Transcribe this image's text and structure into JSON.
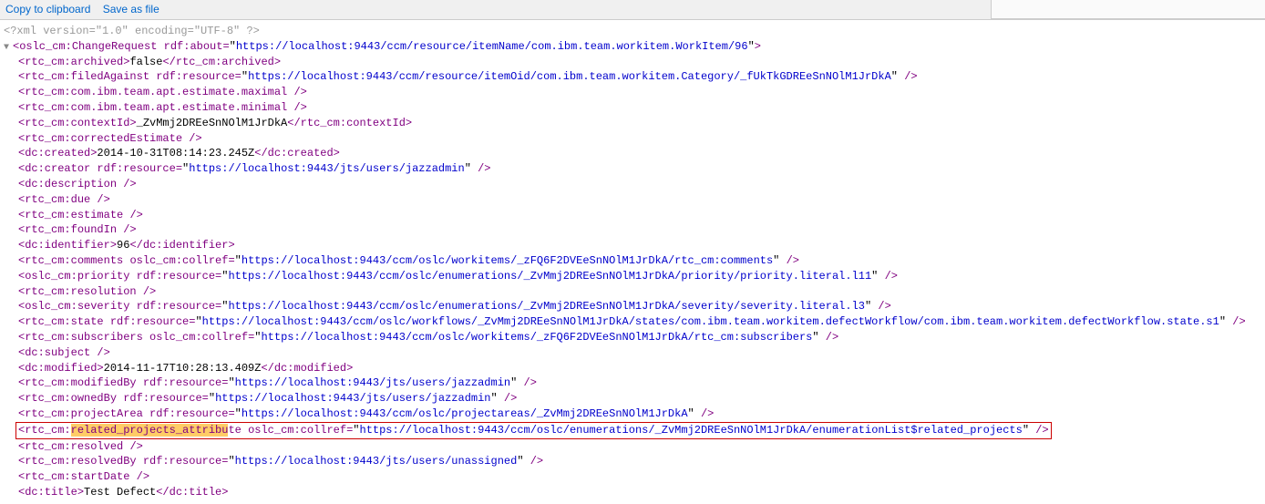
{
  "toolbar": {
    "copy": "Copy to clipboard",
    "save": "Save as file"
  },
  "xml": {
    "declaration": "<?xml version=\"1.0\" encoding=\"UTF-8\" ?>",
    "root": {
      "name": "oslc_cm:ChangeRequest",
      "rdf_about": "https://localhost:9443/ccm/resource/itemName/com.ibm.team.workitem.WorkItem/96"
    },
    "lines": [
      {
        "tag": "rtc_cm:archived",
        "text": "false",
        "close": "rtc_cm:archived"
      },
      {
        "tag": "rtc_cm:filedAgainst",
        "attrs": [
          [
            "rdf:resource",
            "https://localhost:9443/ccm/resource/itemOid/com.ibm.team.workitem.Category/_fUkTkGDREeSnNOlM1JrDkA"
          ]
        ],
        "self": true
      },
      {
        "tag": "rtc_cm:com.ibm.team.apt.estimate.maximal",
        "self": true
      },
      {
        "tag": "rtc_cm:com.ibm.team.apt.estimate.minimal",
        "self": true
      },
      {
        "tag": "rtc_cm:contextId",
        "text": "_ZvMmj2DREeSnNOlM1JrDkA",
        "close": "rtc_cm:contextId"
      },
      {
        "tag": "rtc_cm:correctedEstimate",
        "self": true
      },
      {
        "tag": "dc:created",
        "text": "2014-10-31T08:14:23.245Z",
        "close": "dc:created"
      },
      {
        "tag": "dc:creator",
        "attrs": [
          [
            "rdf:resource",
            "https://localhost:9443/jts/users/jazzadmin"
          ]
        ],
        "self": true
      },
      {
        "tag": "dc:description",
        "self": true
      },
      {
        "tag": "rtc_cm:due",
        "self": true
      },
      {
        "tag": "rtc_cm:estimate",
        "self": true
      },
      {
        "tag": "rtc_cm:foundIn",
        "self": true
      },
      {
        "tag": "dc:identifier",
        "text": "96",
        "close": "dc:identifier"
      },
      {
        "tag": "rtc_cm:comments",
        "attrs": [
          [
            "oslc_cm:collref",
            "https://localhost:9443/ccm/oslc/workitems/_zFQ6F2DVEeSnNOlM1JrDkA/rtc_cm:comments"
          ]
        ],
        "self": true
      },
      {
        "tag": "oslc_cm:priority",
        "attrs": [
          [
            "rdf:resource",
            "https://localhost:9443/ccm/oslc/enumerations/_ZvMmj2DREeSnNOlM1JrDkA/priority/priority.literal.l11"
          ]
        ],
        "self": true
      },
      {
        "tag": "rtc_cm:resolution",
        "self": true
      },
      {
        "tag": "oslc_cm:severity",
        "attrs": [
          [
            "rdf:resource",
            "https://localhost:9443/ccm/oslc/enumerations/_ZvMmj2DREeSnNOlM1JrDkA/severity/severity.literal.l3"
          ]
        ],
        "self": true
      },
      {
        "tag": "rtc_cm:state",
        "attrs": [
          [
            "rdf:resource",
            "https://localhost:9443/ccm/oslc/workflows/_ZvMmj2DREeSnNOlM1JrDkA/states/com.ibm.team.workitem.defectWorkflow/com.ibm.team.workitem.defectWorkflow.state.s1"
          ]
        ],
        "self": true
      },
      {
        "tag": "rtc_cm:subscribers",
        "attrs": [
          [
            "oslc_cm:collref",
            "https://localhost:9443/ccm/oslc/workitems/_zFQ6F2DVEeSnNOlM1JrDkA/rtc_cm:subscribers"
          ]
        ],
        "self": true
      },
      {
        "tag": "dc:subject",
        "self": true
      },
      {
        "tag": "dc:modified",
        "text": "2014-11-17T10:28:13.409Z",
        "close": "dc:modified"
      },
      {
        "tag": "rtc_cm:modifiedBy",
        "attrs": [
          [
            "rdf:resource",
            "https://localhost:9443/jts/users/jazzadmin"
          ]
        ],
        "self": true
      },
      {
        "tag": "rtc_cm:ownedBy",
        "attrs": [
          [
            "rdf:resource",
            "https://localhost:9443/jts/users/jazzadmin"
          ]
        ],
        "self": true
      },
      {
        "tag": "rtc_cm:projectArea",
        "attrs": [
          [
            "rdf:resource",
            "https://localhost:9443/ccm/oslc/projectareas/_ZvMmj2DREeSnNOlM1JrDkA"
          ]
        ],
        "self": true
      },
      {
        "tag": "rtc_cm:",
        "highlight_tag_pre": "related_projects_attribu",
        "highlight_tag_post": "te",
        "attrs": [
          [
            "oslc_cm:collref",
            "https://localhost:9443/ccm/oslc/enumerations/_ZvMmj2DREeSnNOlM1JrDkA/enumerationList$related_projects"
          ]
        ],
        "self": true,
        "boxed": true
      },
      {
        "tag": "rtc_cm:resolved",
        "self": true
      },
      {
        "tag": "rtc_cm:resolvedBy",
        "attrs": [
          [
            "rdf:resource",
            "https://localhost:9443/jts/users/unassigned"
          ]
        ],
        "self": true
      },
      {
        "tag": "rtc_cm:startDate",
        "self": true
      },
      {
        "tag": "dc:title",
        "text": "Test Defect",
        "close": "dc:title"
      }
    ]
  }
}
